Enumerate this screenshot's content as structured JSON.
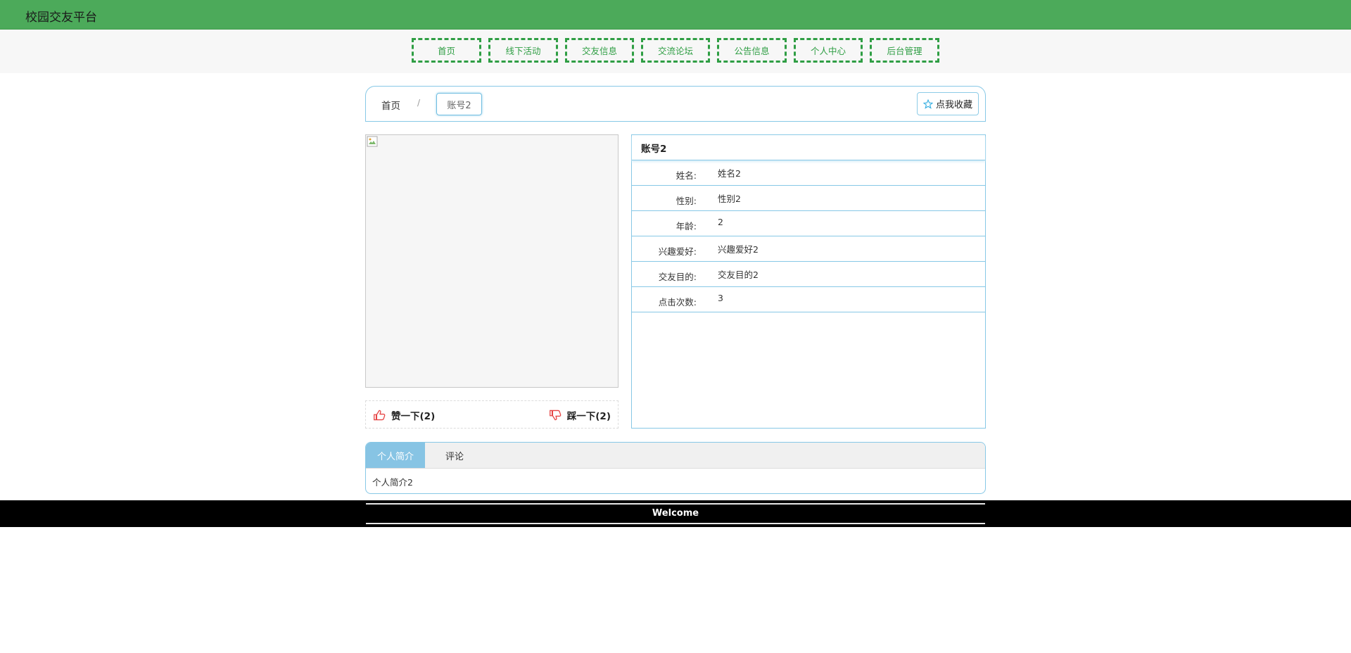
{
  "header": {
    "title": "校园交友平台"
  },
  "nav": {
    "items": [
      "首页",
      "线下活动",
      "交友信息",
      "交流论坛",
      "公告信息",
      "个人中心",
      "后台管理"
    ]
  },
  "breadcrumb": {
    "home": "首页",
    "separator": "/",
    "current": "账号2"
  },
  "favorite": {
    "label": "点我收藏",
    "icon": "star-icon"
  },
  "votes": {
    "like_label": "赞一下(2)",
    "dislike_label": "踩一下(2)",
    "like_icon": "thumb-up-icon",
    "dislike_icon": "thumb-down-icon",
    "icon_color": "#e64545"
  },
  "info": {
    "title": "账号2",
    "rows": [
      {
        "label": "姓名:",
        "value": "姓名2"
      },
      {
        "label": "性别:",
        "value": "性别2"
      },
      {
        "label": "年龄:",
        "value": "2"
      },
      {
        "label": "兴趣爱好:",
        "value": "兴趣爱好2"
      },
      {
        "label": "交友目的:",
        "value": "交友目的2"
      },
      {
        "label": "点击次数:",
        "value": "3"
      }
    ]
  },
  "tabs": {
    "items": [
      "个人简介",
      "评论"
    ],
    "active_index": 0,
    "content": "个人简介2"
  },
  "footer": {
    "text": "Welcome"
  },
  "colors": {
    "header": "#4caa5a",
    "nav_border": "#2f9e44",
    "accent": "#87c8e6",
    "tab_active": "#87c4e4",
    "footer": "#000000"
  }
}
